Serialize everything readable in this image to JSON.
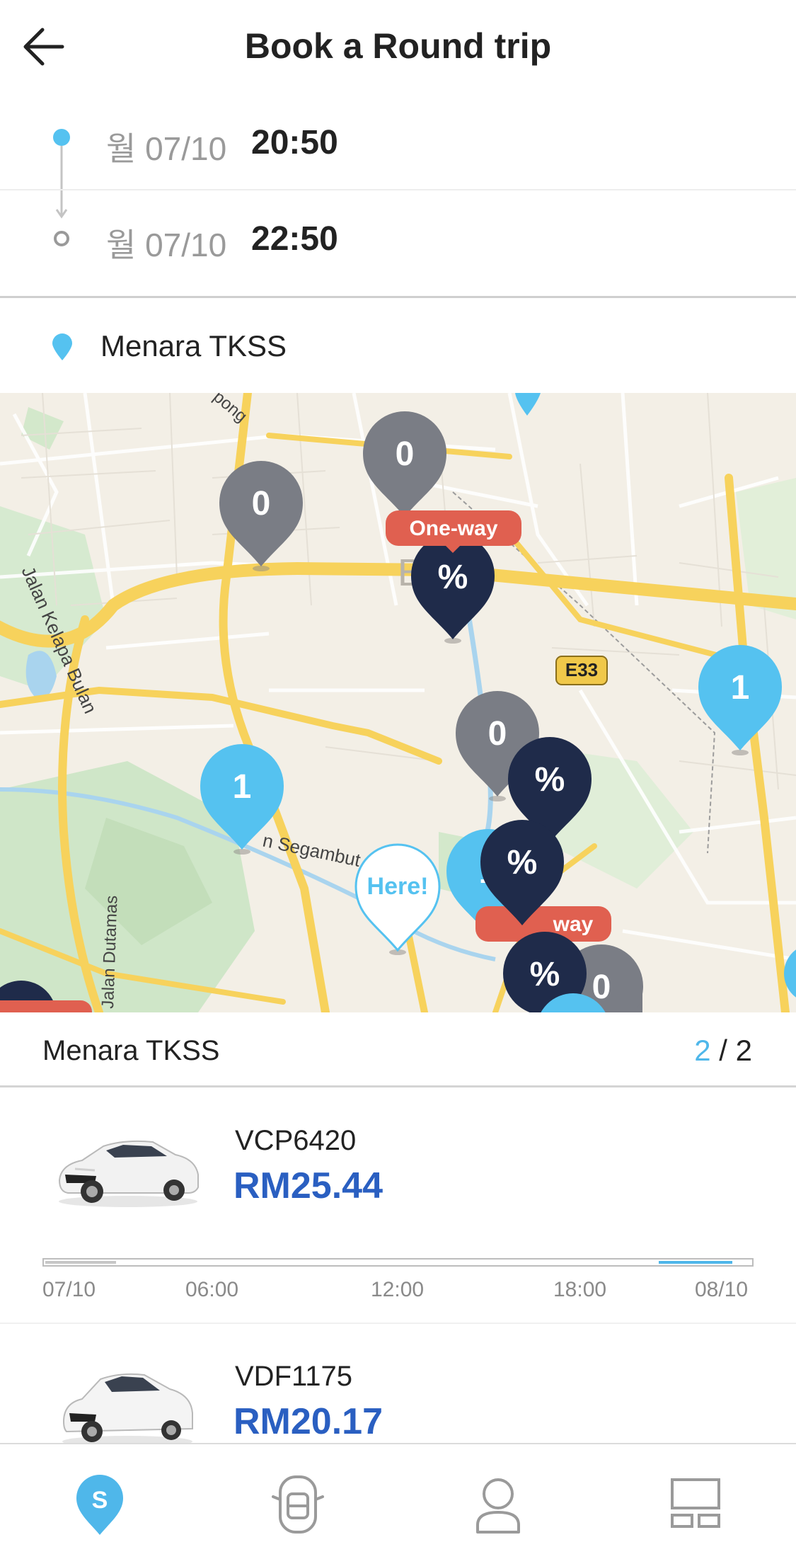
{
  "header": {
    "title": "Book a Round trip",
    "back_icon": "arrow-left-icon"
  },
  "trip": {
    "start": {
      "date": "월 07/10",
      "time": "20:50"
    },
    "end": {
      "date": "월 07/10",
      "time": "22:50"
    }
  },
  "location": {
    "name": "Menara TKSS"
  },
  "map": {
    "labels": {
      "road_kelapa_bulan": "Jalan Kelapa Bulan",
      "road_segambut": "n Segambut",
      "road_dutamas": "Jalan Dutamas",
      "road_kepong": "pong",
      "highway": "E33",
      "district": "B"
    },
    "markers": {
      "grey_a": "0",
      "grey_b": "0",
      "grey_c": "0",
      "grey_d": "0",
      "blue_a": "1",
      "blue_b": "1",
      "blue_c": "1",
      "discount": "%",
      "oneway": "One-way",
      "oneway_partial": "way",
      "here": "Here!"
    },
    "colors": {
      "grey": "#7a7d85",
      "blue": "#55c2f0",
      "navy": "#1f2b4a",
      "red": "#e06050"
    }
  },
  "station": {
    "name": "Menara TKSS",
    "current": "2",
    "separator": " / ",
    "total": "2"
  },
  "cars": [
    {
      "plate": "VCP6420",
      "price": "RM25.44",
      "ticks": [
        "07/10",
        "06:00",
        "12:00",
        "18:00",
        "08/10"
      ]
    },
    {
      "plate": "VDF1175",
      "price": "RM20.17"
    }
  ],
  "nav": {
    "items": [
      "socar-home-icon",
      "car-key-icon",
      "profile-icon",
      "dashboard-icon"
    ],
    "active_color": "#4fb7ea"
  }
}
